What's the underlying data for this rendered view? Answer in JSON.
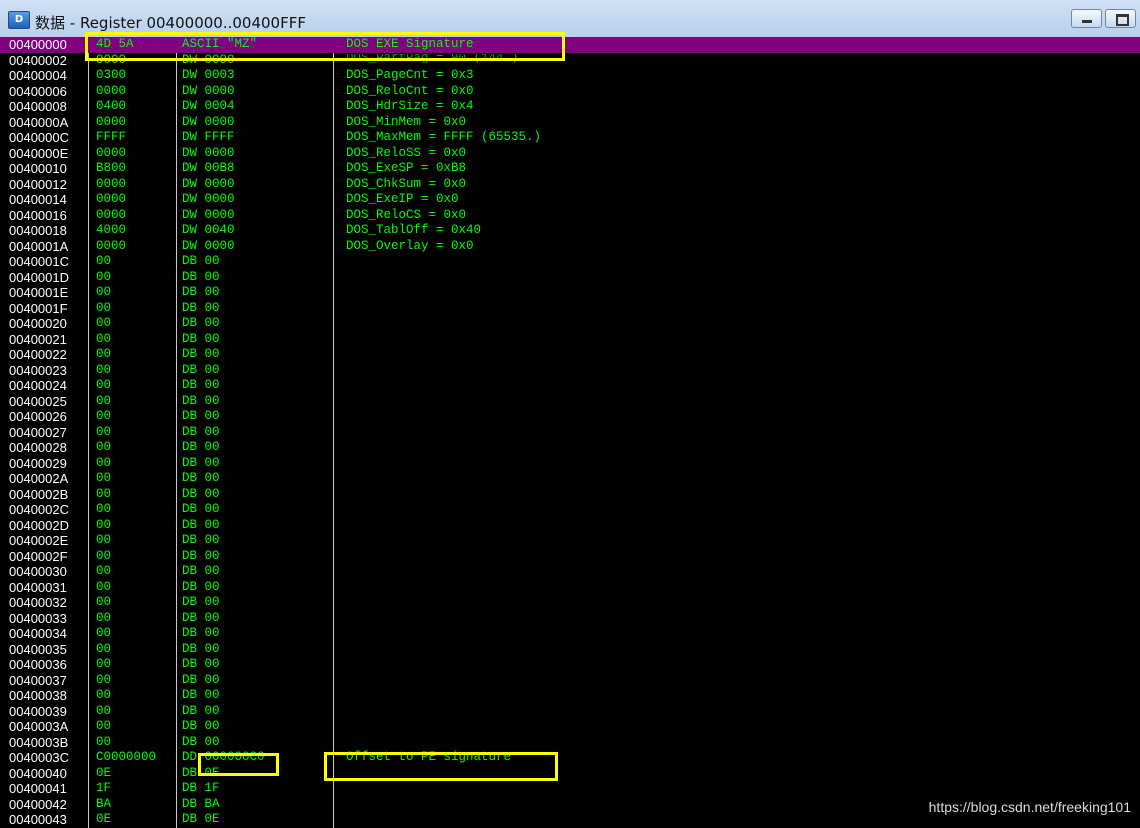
{
  "window": {
    "title": "数据 - Register 00400000..00400FFF",
    "icon_letter": "D",
    "controls": {
      "minimize": "minimize",
      "maximize": "maximize"
    }
  },
  "ghost_text": "DOS_PartPag = 90 (144.)",
  "rows": [
    {
      "addr": "00400000",
      "hex": "4D 5A",
      "disasm": "ASCII \"MZ\"",
      "comment": "DOS EXE Signature",
      "selected": true
    },
    {
      "addr": "00400002",
      "hex": "9000",
      "disasm": "DW 0090",
      "comment": ""
    },
    {
      "addr": "00400004",
      "hex": "0300",
      "disasm": "DW 0003",
      "comment": "DOS_PageCnt = 0x3"
    },
    {
      "addr": "00400006",
      "hex": "0000",
      "disasm": "DW 0000",
      "comment": "DOS_ReloCnt = 0x0"
    },
    {
      "addr": "00400008",
      "hex": "0400",
      "disasm": "DW 0004",
      "comment": "DOS_HdrSize = 0x4"
    },
    {
      "addr": "0040000A",
      "hex": "0000",
      "disasm": "DW 0000",
      "comment": "DOS_MinMem = 0x0"
    },
    {
      "addr": "0040000C",
      "hex": "FFFF",
      "disasm": "DW FFFF",
      "comment": "DOS_MaxMem = FFFF (65535.)"
    },
    {
      "addr": "0040000E",
      "hex": "0000",
      "disasm": "DW 0000",
      "comment": "DOS_ReloSS = 0x0"
    },
    {
      "addr": "00400010",
      "hex": "B800",
      "disasm": "DW 00B8",
      "comment": "DOS_ExeSP = 0xB8"
    },
    {
      "addr": "00400012",
      "hex": "0000",
      "disasm": "DW 0000",
      "comment": "DOS_ChkSum = 0x0"
    },
    {
      "addr": "00400014",
      "hex": "0000",
      "disasm": "DW 0000",
      "comment": "DOS_ExeIP = 0x0"
    },
    {
      "addr": "00400016",
      "hex": "0000",
      "disasm": "DW 0000",
      "comment": "DOS_ReloCS = 0x0"
    },
    {
      "addr": "00400018",
      "hex": "4000",
      "disasm": "DW 0040",
      "comment": "DOS_TablOff = 0x40"
    },
    {
      "addr": "0040001A",
      "hex": "0000",
      "disasm": "DW 0000",
      "comment": "DOS_Overlay = 0x0"
    },
    {
      "addr": "0040001C",
      "hex": "00",
      "disasm": "DB 00",
      "comment": ""
    },
    {
      "addr": "0040001D",
      "hex": "00",
      "disasm": "DB 00",
      "comment": ""
    },
    {
      "addr": "0040001E",
      "hex": "00",
      "disasm": "DB 00",
      "comment": ""
    },
    {
      "addr": "0040001F",
      "hex": "00",
      "disasm": "DB 00",
      "comment": ""
    },
    {
      "addr": "00400020",
      "hex": "00",
      "disasm": "DB 00",
      "comment": ""
    },
    {
      "addr": "00400021",
      "hex": "00",
      "disasm": "DB 00",
      "comment": ""
    },
    {
      "addr": "00400022",
      "hex": "00",
      "disasm": "DB 00",
      "comment": ""
    },
    {
      "addr": "00400023",
      "hex": "00",
      "disasm": "DB 00",
      "comment": ""
    },
    {
      "addr": "00400024",
      "hex": "00",
      "disasm": "DB 00",
      "comment": ""
    },
    {
      "addr": "00400025",
      "hex": "00",
      "disasm": "DB 00",
      "comment": ""
    },
    {
      "addr": "00400026",
      "hex": "00",
      "disasm": "DB 00",
      "comment": ""
    },
    {
      "addr": "00400027",
      "hex": "00",
      "disasm": "DB 00",
      "comment": ""
    },
    {
      "addr": "00400028",
      "hex": "00",
      "disasm": "DB 00",
      "comment": ""
    },
    {
      "addr": "00400029",
      "hex": "00",
      "disasm": "DB 00",
      "comment": ""
    },
    {
      "addr": "0040002A",
      "hex": "00",
      "disasm": "DB 00",
      "comment": ""
    },
    {
      "addr": "0040002B",
      "hex": "00",
      "disasm": "DB 00",
      "comment": ""
    },
    {
      "addr": "0040002C",
      "hex": "00",
      "disasm": "DB 00",
      "comment": ""
    },
    {
      "addr": "0040002D",
      "hex": "00",
      "disasm": "DB 00",
      "comment": ""
    },
    {
      "addr": "0040002E",
      "hex": "00",
      "disasm": "DB 00",
      "comment": ""
    },
    {
      "addr": "0040002F",
      "hex": "00",
      "disasm": "DB 00",
      "comment": ""
    },
    {
      "addr": "00400030",
      "hex": "00",
      "disasm": "DB 00",
      "comment": ""
    },
    {
      "addr": "00400031",
      "hex": "00",
      "disasm": "DB 00",
      "comment": ""
    },
    {
      "addr": "00400032",
      "hex": "00",
      "disasm": "DB 00",
      "comment": ""
    },
    {
      "addr": "00400033",
      "hex": "00",
      "disasm": "DB 00",
      "comment": ""
    },
    {
      "addr": "00400034",
      "hex": "00",
      "disasm": "DB 00",
      "comment": ""
    },
    {
      "addr": "00400035",
      "hex": "00",
      "disasm": "DB 00",
      "comment": ""
    },
    {
      "addr": "00400036",
      "hex": "00",
      "disasm": "DB 00",
      "comment": ""
    },
    {
      "addr": "00400037",
      "hex": "00",
      "disasm": "DB 00",
      "comment": ""
    },
    {
      "addr": "00400038",
      "hex": "00",
      "disasm": "DB 00",
      "comment": ""
    },
    {
      "addr": "00400039",
      "hex": "00",
      "disasm": "DB 00",
      "comment": ""
    },
    {
      "addr": "0040003A",
      "hex": "00",
      "disasm": "DB 00",
      "comment": ""
    },
    {
      "addr": "0040003B",
      "hex": "00",
      "disasm": "DB 00",
      "comment": ""
    },
    {
      "addr": "0040003C",
      "hex": "C0000000",
      "disasm": "DD 000000C0",
      "comment": "Offset to PE signature"
    },
    {
      "addr": "00400040",
      "hex": "0E",
      "disasm": "DB 0E",
      "comment": ""
    },
    {
      "addr": "00400041",
      "hex": "1F",
      "disasm": "DB 1F",
      "comment": ""
    },
    {
      "addr": "00400042",
      "hex": "BA",
      "disasm": "DB BA",
      "comment": ""
    },
    {
      "addr": "00400043",
      "hex": "0E",
      "disasm": "DB 0E",
      "comment": ""
    }
  ],
  "watermark": "https://blog.csdn.net/freeking101",
  "colors": {
    "selection": "#800080",
    "text": "#00ff00",
    "address": "#ffffff",
    "highlight": "#ffff00",
    "background": "#000000"
  }
}
